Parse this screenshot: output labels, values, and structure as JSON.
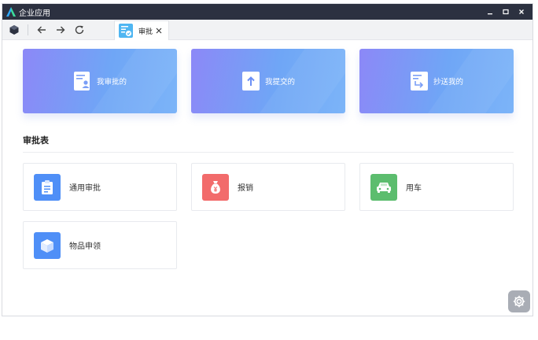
{
  "window": {
    "title": "企业应用"
  },
  "tab": {
    "label": "审批"
  },
  "top_cards": [
    {
      "label": "我审批的",
      "icon": "document-user-icon"
    },
    {
      "label": "我提交的",
      "icon": "upload-document-icon"
    },
    {
      "label": "抄送我的",
      "icon": "cc-forward-document-icon"
    }
  ],
  "section": {
    "title": "审批表"
  },
  "apps": [
    {
      "label": "通用审批",
      "icon": "clipboard-icon",
      "color": "#4f8ff7"
    },
    {
      "label": "报销",
      "icon": "money-bag-icon",
      "color": "#f26b6b"
    },
    {
      "label": "用车",
      "icon": "car-icon",
      "color": "#5cbd6e"
    },
    {
      "label": "物品申领",
      "icon": "box-icon",
      "color": "#4f8ff7"
    }
  ]
}
